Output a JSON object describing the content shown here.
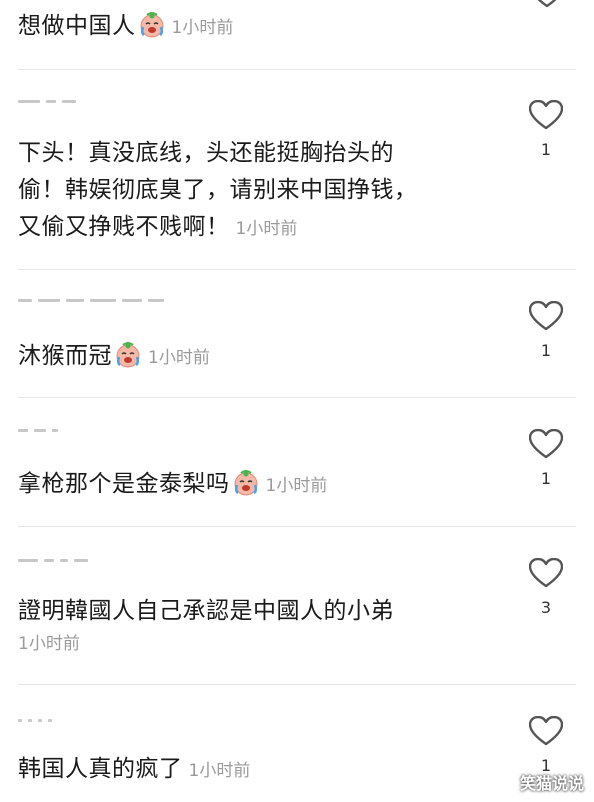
{
  "comments": [
    {
      "text": "想做中国人",
      "emoji": "crying-laughing-emoji",
      "time": "1小时前",
      "likes": ""
    },
    {
      "text": "下头！真没底线，头还能挺胸抬头的偷！韩娱彻底臭了，请别来中国挣钱，又偷又挣贱不贱啊！",
      "line1": "下头！真没底线，头还能挺胸抬头的",
      "line2": "偷！韩娱彻底臭了，请别来中国挣钱，",
      "line3": "又偷又挣贱不贱啊！",
      "time": "1小时前",
      "likes": "1"
    },
    {
      "text": "沐猴而冠",
      "emoji": "crying-laughing-emoji",
      "time": "1小时前",
      "likes": "1"
    },
    {
      "text": "拿枪那个是金泰梨吗",
      "emoji": "crying-laughing-emoji",
      "time": "1小时前",
      "likes": "1"
    },
    {
      "text": "證明韓國人自己承認是中國人的小弟",
      "time": "1小时前",
      "likes": "3"
    },
    {
      "text": "韩国人真的疯了",
      "time": "1小时前",
      "likes": "1"
    }
  ],
  "watermark": "笑猫说说",
  "colors": {
    "text": "#1a1a1a",
    "time": "#9a9a9a",
    "divider": "#e6e6e6",
    "heart_stroke": "#555555"
  }
}
